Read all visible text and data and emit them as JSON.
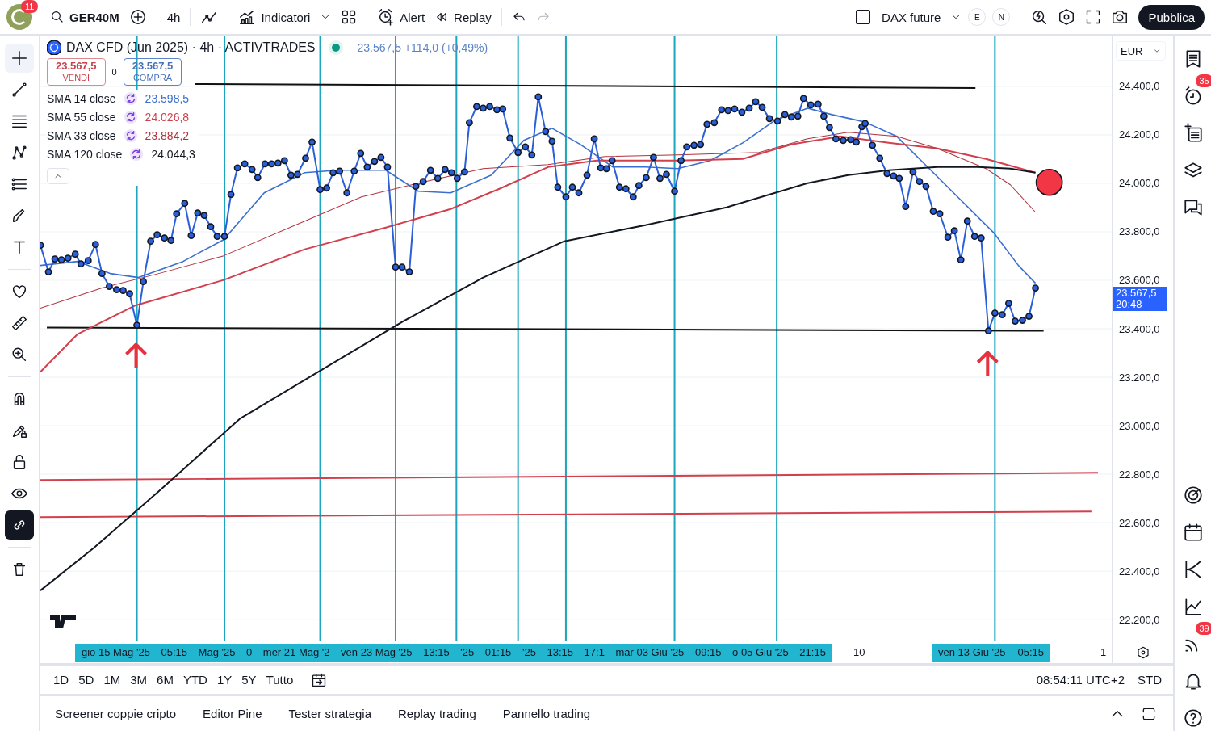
{
  "top_bar": {
    "avatar_badge": "11",
    "symbol": "GER40M",
    "interval": "4h",
    "indicators": "Indicatori",
    "alert": "Alert",
    "replay": "Replay",
    "history": [
      {
        "kind": "undo",
        "disabled": false
      },
      {
        "kind": "redo",
        "disabled": true
      }
    ],
    "layout_name": "DAX future",
    "session_badges": [
      "E",
      "N"
    ],
    "publish": "Pubblica"
  },
  "left_toolbar": [
    {
      "kind": "crosshair",
      "selected": true
    },
    {
      "kind": "trendline",
      "selected": false
    },
    {
      "kind": "fib",
      "selected": false
    },
    {
      "kind": "pattern",
      "selected": false
    },
    {
      "kind": "forecast",
      "selected": false
    },
    {
      "kind": "brush",
      "selected": false
    },
    {
      "kind": "text",
      "selected": false
    },
    {
      "kind": "heart",
      "selected": false
    },
    {
      "kind": "ruler",
      "selected": false
    },
    {
      "kind": "zoom",
      "selected": false
    },
    {
      "kind": "magnet",
      "selected": false
    },
    {
      "kind": "drawlock",
      "selected": false
    },
    {
      "kind": "lock",
      "selected": false
    },
    {
      "kind": "eye",
      "selected": false
    },
    {
      "kind": "link",
      "selected": true
    },
    {
      "kind": "trash",
      "selected": false
    }
  ],
  "legend": {
    "title": "DAX CFD (Jun 2025) · 4h · ACTIVTRADES",
    "market_open": true,
    "quote": "23.567,5 +114,0 (+0,49%)",
    "sell": {
      "price": "23.567,5",
      "label": "VENDI"
    },
    "spread": "0",
    "buy": {
      "price": "23.567,5",
      "label": "COMPRA"
    },
    "indicators": [
      {
        "name": "SMA 14 close",
        "value": "23.598,5",
        "color": "#3a6fd0"
      },
      {
        "name": "SMA 55 close",
        "value": "24.026,8",
        "color": "#d2404d"
      },
      {
        "name": "SMA 33 close",
        "value": "23.884,2",
        "color": "#b0333f"
      },
      {
        "name": "SMA 120 close",
        "value": "24.044,3",
        "color": "#131722"
      }
    ]
  },
  "price_axis": {
    "currency": "EUR",
    "ticks": [
      "24.400,0",
      "24.200,0",
      "24.000,0",
      "23.800,0",
      "23.600,0",
      "23.400,0",
      "23.200,0",
      "23.000,0",
      "22.800,0",
      "22.600,0",
      "22.400,0",
      "22.200,0"
    ],
    "last_price": "23.567,5",
    "countdown": "20:48"
  },
  "time_axis": [
    {
      "highlighted": true,
      "labels": [
        "gio 15 Mag '25",
        "05:15",
        "Mag '25",
        "0",
        "mer 21 Mag '2",
        "ven 23 Mag '25",
        "13:15",
        "'25",
        "01:15",
        "'25",
        "13:15",
        "17:1",
        "mar 03 Giu '25",
        "09:15",
        "o 05 Giu '25",
        "21:15"
      ]
    },
    {
      "highlighted": false,
      "labels": [
        "10"
      ]
    },
    {
      "highlighted": true,
      "labels": [
        "ven 13 Giu '25",
        "05:15"
      ]
    },
    {
      "highlighted": false,
      "labels": [
        "1"
      ]
    }
  ],
  "range_bar": {
    "ranges": [
      {
        "label": "1D",
        "selected": false
      },
      {
        "label": "5D",
        "selected": false
      },
      {
        "label": "1M",
        "selected": false
      },
      {
        "label": "3M",
        "selected": false
      },
      {
        "label": "6M",
        "selected": false
      },
      {
        "label": "YTD",
        "selected": false
      },
      {
        "label": "1Y",
        "selected": false
      },
      {
        "label": "5Y",
        "selected": false
      },
      {
        "label": "Tutto",
        "selected": false
      }
    ],
    "clock": "08:54:11 UTC+2",
    "session": "STD"
  },
  "bottom_panel": {
    "tabs": [
      "Screener coppie cripto",
      "Editor Pine",
      "Tester strategia",
      "Replay trading",
      "Pannello trading"
    ]
  },
  "right_sidebar": [
    {
      "kind": "watchlist"
    },
    {
      "kind": "alerts",
      "badge": "35"
    },
    {
      "kind": "hotlist"
    },
    {
      "kind": "layers"
    },
    {
      "kind": "chat"
    },
    {
      "kind": "gap"
    },
    {
      "kind": "target"
    },
    {
      "kind": "calendar"
    },
    {
      "kind": "curve"
    },
    {
      "kind": "ideas"
    },
    {
      "kind": "signal",
      "badge": "39"
    },
    {
      "kind": "bell"
    },
    {
      "kind": "help"
    }
  ]
}
